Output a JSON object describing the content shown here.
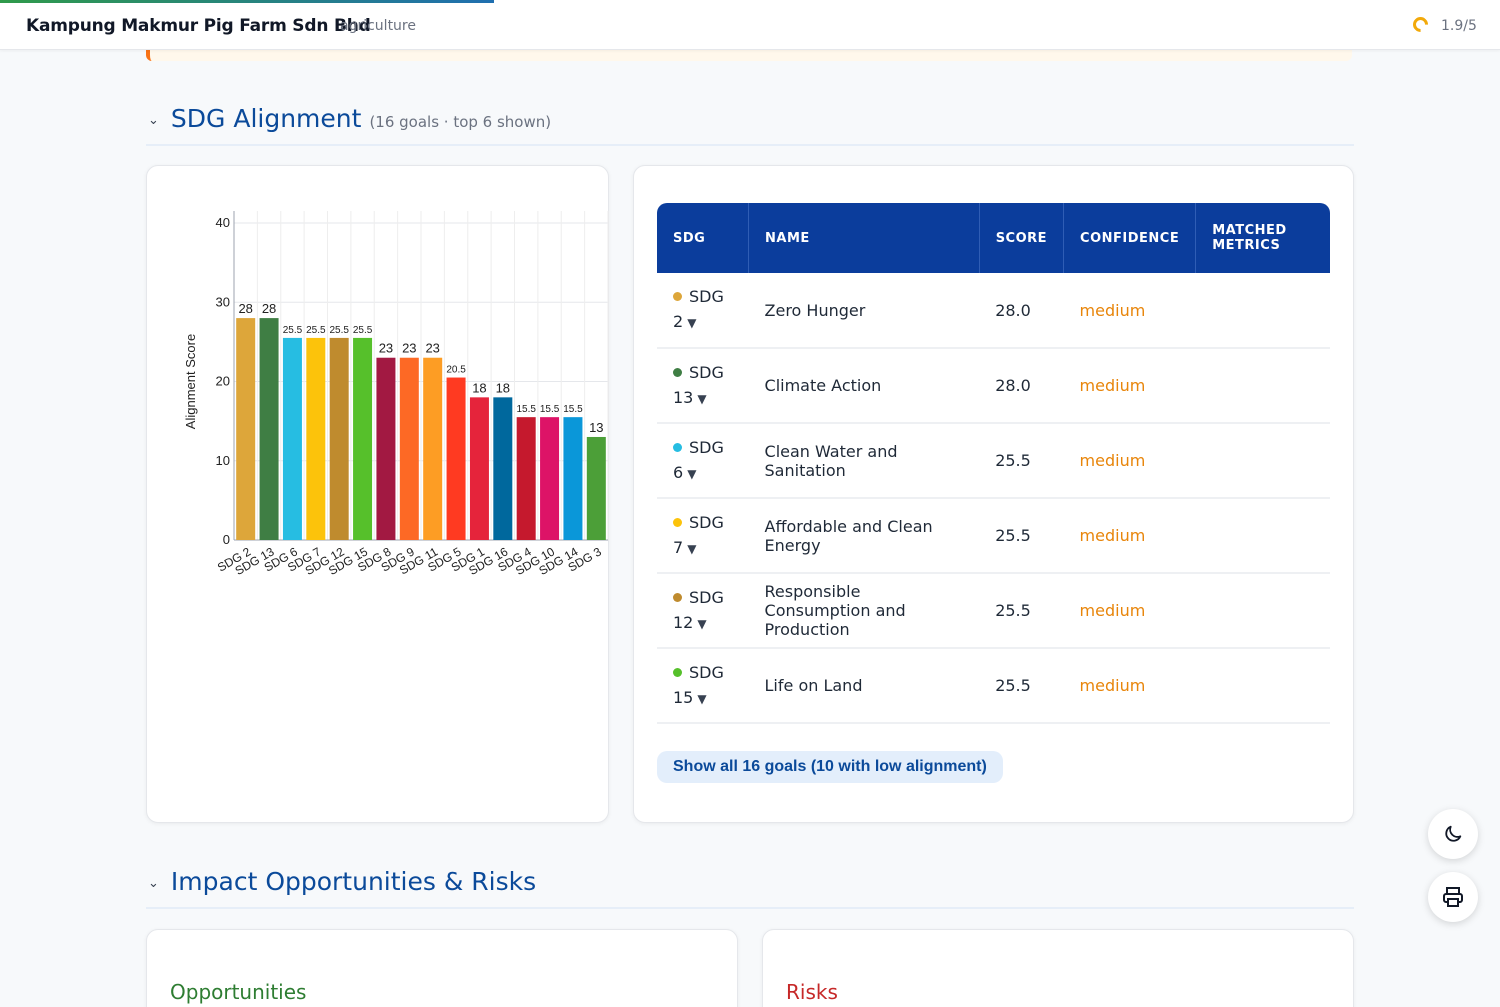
{
  "header": {
    "company": "Kampung Makmur Pig Farm Sdn Bhd",
    "sector": "agriculture",
    "score": "1.9/5",
    "score_color": "#f2a90a"
  },
  "sdg_section": {
    "title": "SDG Alignment",
    "subtitle": "(16 goals · top 6 shown)",
    "show_all_label": "Show all 16 goals (10 with low alignment)"
  },
  "chart_data": {
    "type": "bar",
    "ylabel": "Alignment Score",
    "ylim": [
      0,
      40
    ],
    "yticks": [
      0,
      10,
      20,
      30,
      40
    ],
    "grid": true,
    "categories": [
      "SDG 2",
      "SDG 13",
      "SDG 6",
      "SDG 7",
      "SDG 12",
      "SDG 15",
      "SDG 8",
      "SDG 9",
      "SDG 11",
      "SDG 5",
      "SDG 1",
      "SDG 16",
      "SDG 4",
      "SDG 10",
      "SDG 14",
      "SDG 3"
    ],
    "values": [
      28,
      28,
      25.5,
      25.5,
      25.5,
      25.5,
      23,
      23,
      23,
      20.5,
      18,
      18,
      15.5,
      15.5,
      15.5,
      13
    ],
    "colors": [
      "#DDA63A",
      "#3F7E44",
      "#26BDE2",
      "#FCC30B",
      "#BF8B2E",
      "#56C02B",
      "#A21942",
      "#FD6925",
      "#FD9D24",
      "#FF3A21",
      "#E5243B",
      "#00689D",
      "#C5192D",
      "#DD1367",
      "#0A97D9",
      "#4C9F38"
    ]
  },
  "table": {
    "headers": [
      "SDG",
      "NAME",
      "SCORE",
      "CONFIDENCE",
      "MATCHED METRICS"
    ],
    "rows": [
      {
        "sdg": "SDG 2",
        "color": "#DDA63A",
        "name": "Zero Hunger",
        "score": "28.0",
        "confidence": "medium",
        "metrics": ""
      },
      {
        "sdg": "SDG 13",
        "color": "#3F7E44",
        "name": "Climate Action",
        "score": "28.0",
        "confidence": "medium",
        "metrics": ""
      },
      {
        "sdg": "SDG 6",
        "color": "#26BDE2",
        "name": "Clean Water and Sanitation",
        "score": "25.5",
        "confidence": "medium",
        "metrics": ""
      },
      {
        "sdg": "SDG 7",
        "color": "#FCC30B",
        "name": "Affordable and Clean Energy",
        "score": "25.5",
        "confidence": "medium",
        "metrics": ""
      },
      {
        "sdg": "SDG 12",
        "color": "#BF8B2E",
        "name": "Responsible Consumption and Production",
        "score": "25.5",
        "confidence": "medium",
        "metrics": ""
      },
      {
        "sdg": "SDG 15",
        "color": "#56C02B",
        "name": "Life on Land",
        "score": "25.5",
        "confidence": "medium",
        "metrics": ""
      }
    ]
  },
  "impact_section": {
    "title": "Impact Opportunities & Risks",
    "opportunities_title": "Opportunities",
    "risks_title": "Risks"
  },
  "fabs": {
    "theme_icon": "moon-icon",
    "print_icon": "printer-icon"
  }
}
